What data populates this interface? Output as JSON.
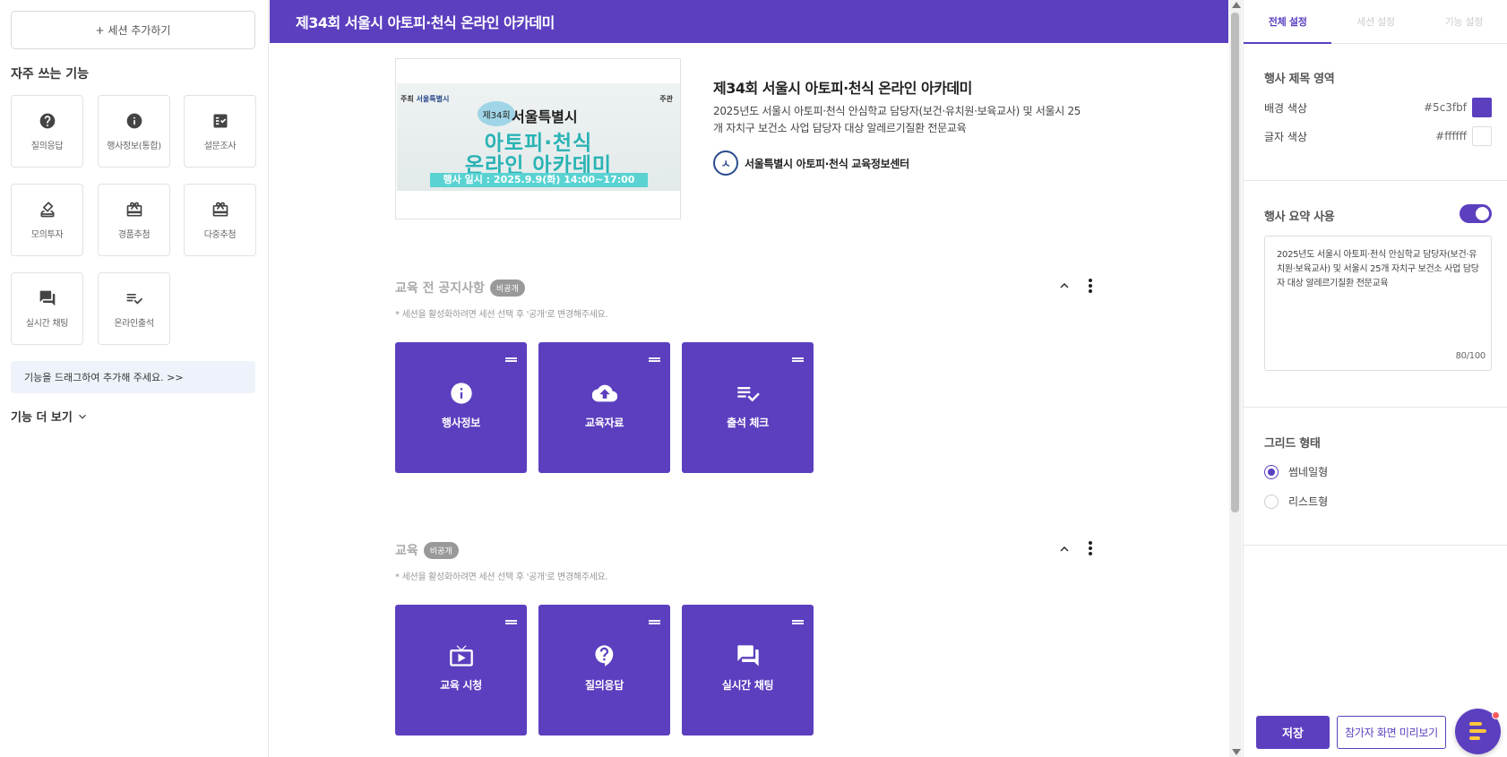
{
  "left_panel": {
    "add_session": "+ 세션 추가하기",
    "frequent_title": "자주 쓰는 기능",
    "tiles": [
      {
        "label": "질의응답",
        "icon": "question-circle-icon"
      },
      {
        "label": "행사정보(통합)",
        "icon": "info-circle-icon"
      },
      {
        "label": "설문조사",
        "icon": "survey-icon"
      },
      {
        "label": "모의투자",
        "icon": "vote-icon"
      },
      {
        "label": "경품추첨",
        "icon": "gift-icon"
      },
      {
        "label": "다중추첨",
        "icon": "gift-multi-icon"
      },
      {
        "label": "실시간 채팅",
        "icon": "chat-icon"
      },
      {
        "label": "온라인출석",
        "icon": "checklist-icon"
      }
    ],
    "drag_hint": "기능을 드래그하여 추가해 주세요. >>",
    "more": "기능 더 보기"
  },
  "header": {
    "title": "제34회 서울시 아토피·천식 온라인 아카데미",
    "bg_color": "#5c3fbf"
  },
  "event": {
    "banner": {
      "organizer": "주최",
      "organizer_name": "서울특별시",
      "host": "주관",
      "edition": "제34회",
      "city": "서울특별시",
      "line1": "아토피·천식",
      "line2": "온라인 아카데미",
      "date": "행사 일시 : 2025.9.9(화) 14:00~17:00"
    },
    "title": "제34회 서울시 아토피·천식 온라인 아카데미",
    "description": "2025년도 서울시 아토피·천식 안심학교 담당자(보건·유치원·보육교사) 및 서울시 25개 자치구 보건소 사업 담당자 대상 알레르기질환 전문교육",
    "organizer": "서울특별시 아토피·천식 교육정보센터"
  },
  "sections": [
    {
      "title": "교육 전 공지사항",
      "badge": "비공개",
      "note": "* 세션을 활성화하려면 세션 선택 후 '공개'로 변경해주세요.",
      "cards": [
        {
          "label": "행사정보",
          "icon": "info-circle-icon"
        },
        {
          "label": "교육자료",
          "icon": "cloud-upload-icon"
        },
        {
          "label": "출석 체크",
          "icon": "checklist-icon"
        }
      ]
    },
    {
      "title": "교육",
      "badge": "비공개",
      "note": "* 세션을 활성화하려면 세션 선택 후 '공개'로 변경해주세요.",
      "cards": [
        {
          "label": "교육 시청",
          "icon": "tv-play-icon"
        },
        {
          "label": "질의응답",
          "icon": "question-bubble-icon"
        },
        {
          "label": "실시간 채팅",
          "icon": "chat-icon"
        }
      ]
    }
  ],
  "right_panel": {
    "tabs": [
      "전체 설정",
      "세션 설정",
      "기능 설정"
    ],
    "active_tab": 0,
    "title_area_label": "행사 제목 영역",
    "bg_color_label": "배경 색상",
    "bg_color_value": "#5c3fbf",
    "text_color_label": "글자 색상",
    "text_color_value": "#ffffff",
    "summary_label": "행사 요약 사용",
    "summary_enabled": true,
    "summary_text": "2025년도 서울시 아토피·천식 안심학교 담당자(보건·유치원·보육교사) 및 서울시 25개 자치구 보건소 사업 담당자 대상 알레르기질환 전문교육",
    "summary_count": "80/100",
    "grid_label": "그리드 형태",
    "grid_options": [
      "썸네일형",
      "리스트형"
    ],
    "grid_selected": 0,
    "save": "저장",
    "preview": "참가자 화면 미리보기"
  }
}
